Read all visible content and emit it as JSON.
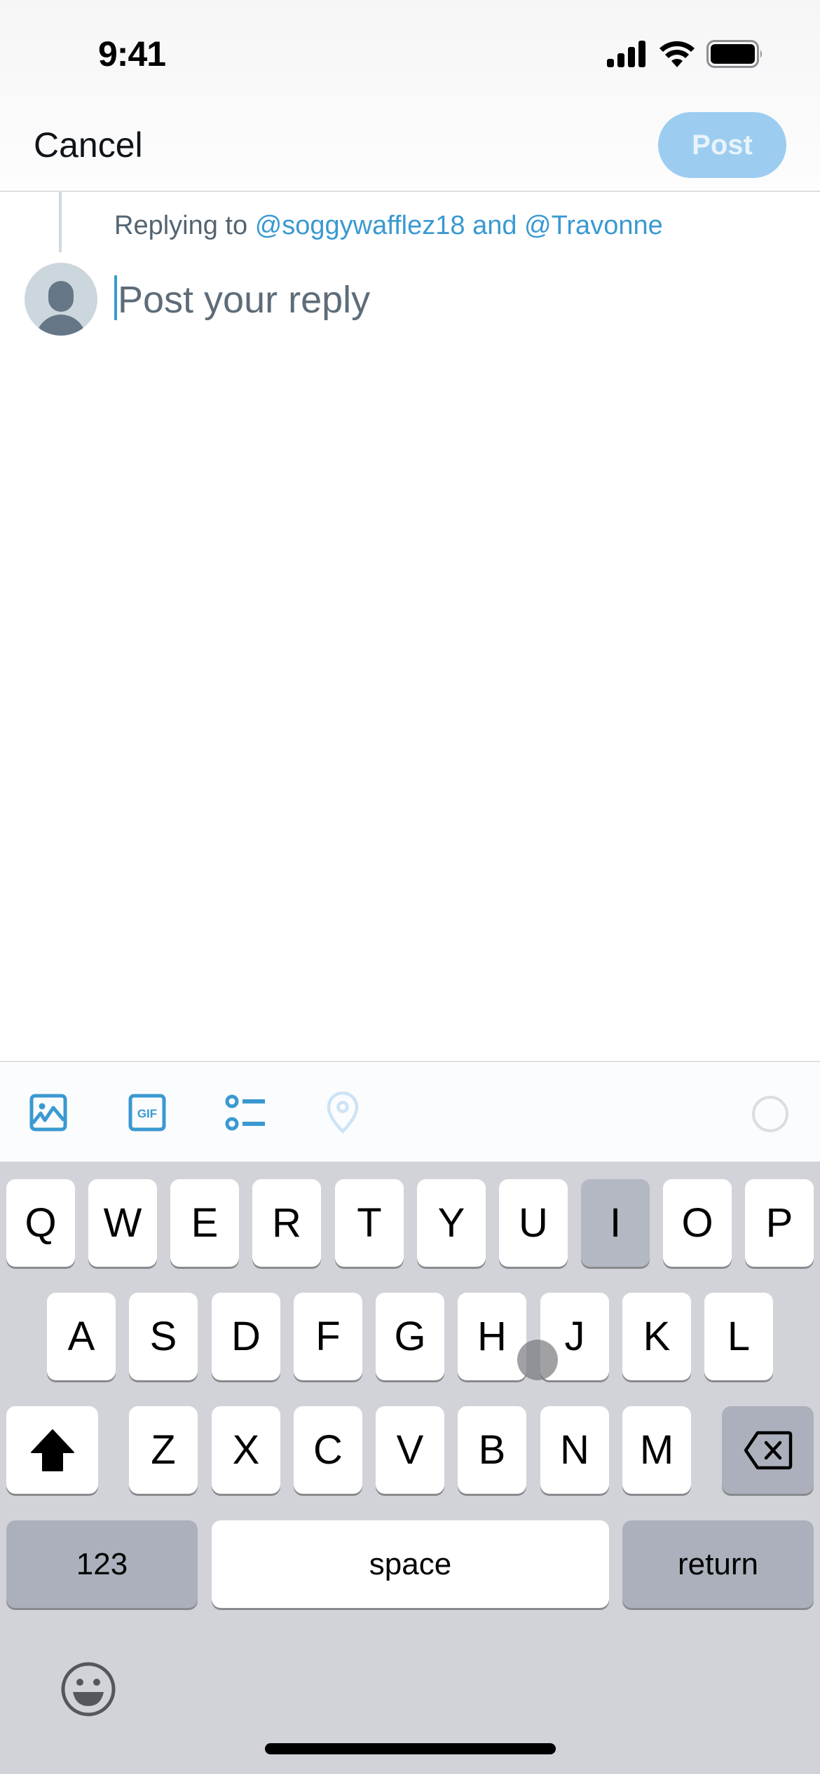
{
  "status_bar": {
    "time": "9:41",
    "icons": [
      "cellular-signal-icon",
      "wifi-icon",
      "battery-icon"
    ]
  },
  "header": {
    "cancel_label": "Cancel",
    "post_label": "Post",
    "post_enabled": false
  },
  "composer": {
    "replying_prefix": "Replying to",
    "replying_handles": "@soggywafflez18 and @Travonne",
    "input_value": "",
    "input_placeholder": "Post your reply"
  },
  "toolbar": {
    "icons": [
      "image-icon",
      "gif-icon",
      "poll-icon",
      "location-icon"
    ],
    "character_counter": "character-count-ring"
  },
  "keyboard": {
    "row1": [
      "Q",
      "W",
      "E",
      "R",
      "T",
      "Y",
      "U",
      "I",
      "O",
      "P"
    ],
    "row2": [
      "A",
      "S",
      "D",
      "F",
      "G",
      "H",
      "J",
      "K",
      "L"
    ],
    "row3": [
      "Z",
      "X",
      "C",
      "V",
      "B",
      "N",
      "M"
    ],
    "pressed_key": "I",
    "numbers_label": "123",
    "space_label": "space",
    "return_label": "return"
  },
  "colors": {
    "accent": "#1d9bf0",
    "post_disabled": "#9ccdf0",
    "handle_link": "#3a99d1",
    "keyboard_bg": "#d1d3d9"
  }
}
